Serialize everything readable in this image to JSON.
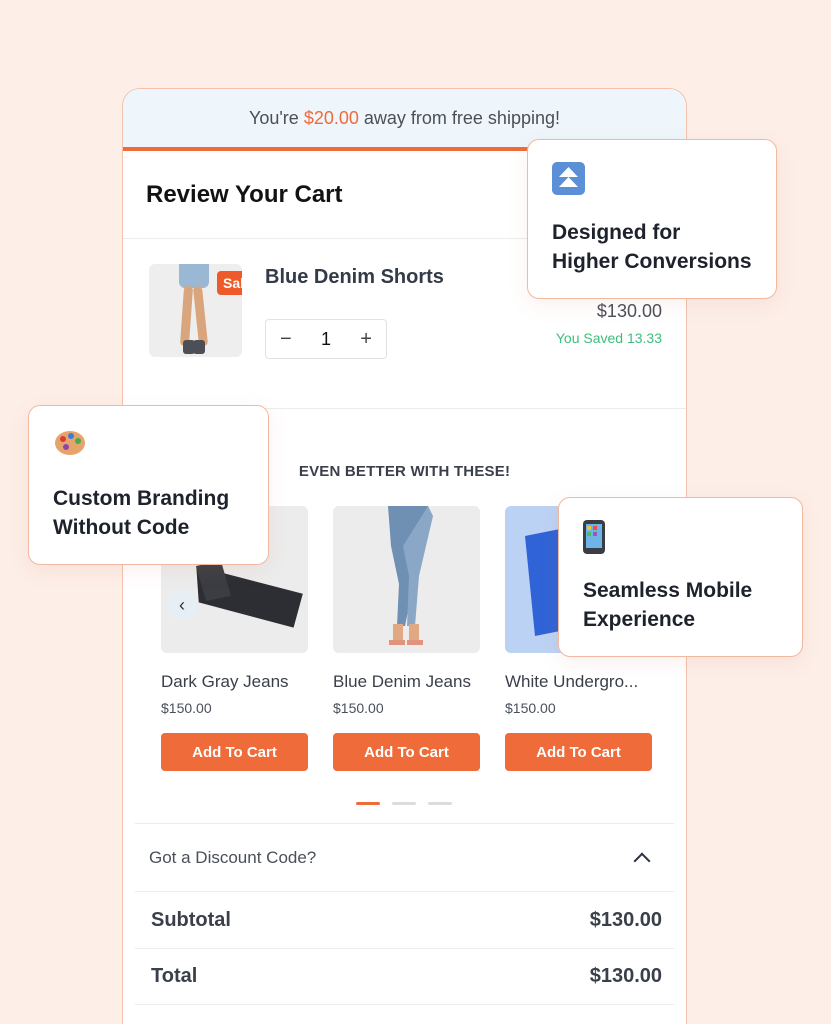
{
  "shipping_banner": {
    "prefix": "You're",
    "amount": "$20.00",
    "suffix": "away from free shipping!"
  },
  "cart": {
    "title": "Review Your Cart",
    "item": {
      "badge": "Sale!",
      "name": "Blue Denim Shorts",
      "quantity": "1",
      "decrement": "−",
      "increment": "+",
      "price": "$130.00",
      "saved": "You Saved 13.33"
    }
  },
  "upsell": {
    "title": "EVEN BETTER WITH THESE!",
    "prev_arrow": "‹",
    "products": [
      {
        "name": "Dark Gray Jeans",
        "price": "$150.00",
        "button": "Add To Cart"
      },
      {
        "name": "Blue Denim Jeans",
        "price": "$150.00",
        "button": "Add To Cart"
      },
      {
        "name": "White Undergro...",
        "price": "$150.00",
        "button": "Add To Cart"
      }
    ],
    "pagination_active": 1,
    "pagination_count": 3
  },
  "discount": {
    "label": "Got a Discount Code?"
  },
  "summary": {
    "subtotal_label": "Subtotal",
    "subtotal_value": "$130.00",
    "total_label": "Total",
    "total_value": "$130.00"
  },
  "callouts": [
    {
      "icon": "double-up-arrow-icon",
      "line1": "Designed for",
      "line2": "Higher Conversions"
    },
    {
      "icon": "palette-icon",
      "line1": "Custom Branding",
      "line2": "Without Code"
    },
    {
      "icon": "mobile-phone-icon",
      "line1": "Seamless Mobile",
      "line2": "Experience"
    }
  ],
  "colors": {
    "accent": "#ef6b3a",
    "background": "#fdeee8",
    "saved_green": "#3cbf7b",
    "banner_bg": "#eef6fb"
  }
}
